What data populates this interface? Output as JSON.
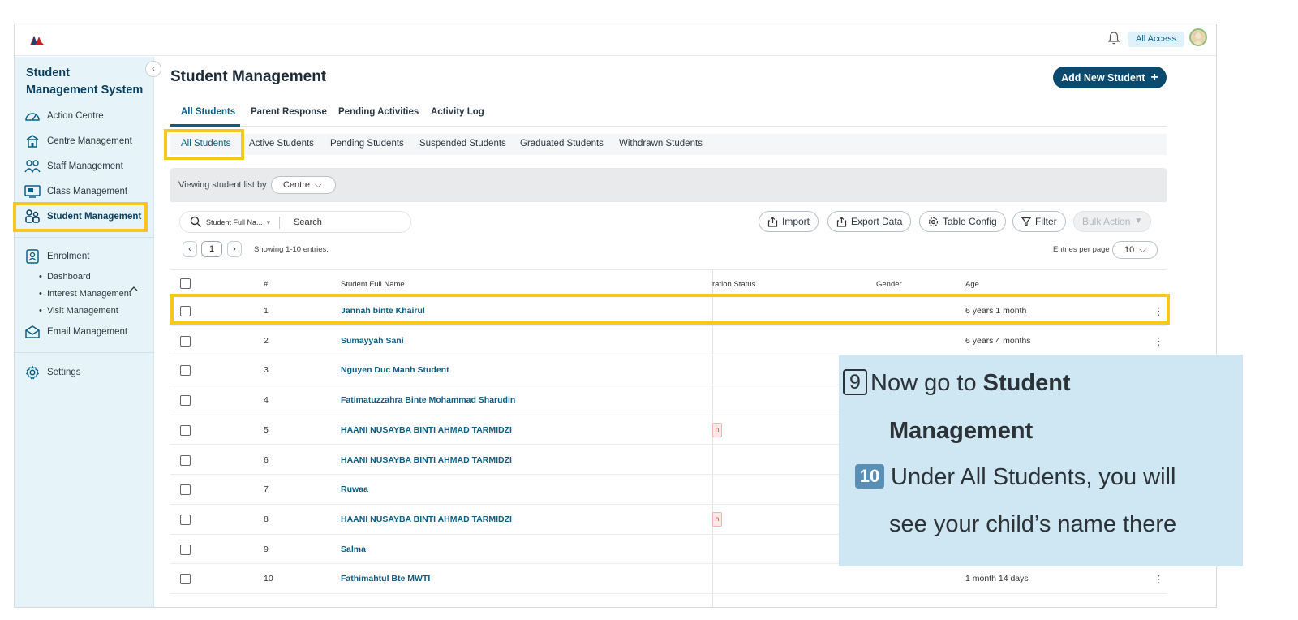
{
  "header": {
    "access_badge": "All Access"
  },
  "sidebar": {
    "title": "Student Management System",
    "items": [
      {
        "label": "Action Centre",
        "icon": "gauge-icon"
      },
      {
        "label": "Centre Management",
        "icon": "school-building-icon"
      },
      {
        "label": "Staff Management",
        "icon": "staff-group-icon"
      },
      {
        "label": "Class Management",
        "icon": "class-board-icon"
      },
      {
        "label": "Student Management",
        "icon": "students-icon"
      },
      {
        "label": "Enrolment",
        "icon": "enrolment-icon"
      },
      {
        "label": "Email Management",
        "icon": "email-icon"
      },
      {
        "label": "Settings",
        "icon": "gear-icon"
      }
    ],
    "enrolment_sub": [
      "Dashboard",
      "Interest Management",
      "Visit Management"
    ]
  },
  "main": {
    "title": "Student Management",
    "add_button": "Add New Student",
    "tabs": [
      "All Students",
      "Parent Response",
      "Pending Activities",
      "Activity Log"
    ],
    "subtabs": [
      "All Students",
      "Active Students",
      "Pending Students",
      "Suspended Students",
      "Graduated Students",
      "Withdrawn Students"
    ],
    "viewing_label": "Viewing student list by",
    "viewing_value": "Centre",
    "search": {
      "field": "Student Full Na...",
      "placeholder": "Search"
    },
    "actions": {
      "import": "Import",
      "export": "Export Data",
      "table_config": "Table Config",
      "filter": "Filter",
      "bulk_action": "Bulk Action"
    },
    "pagination": {
      "page": "1",
      "showing": "Showing 1-10 entries.",
      "entries_label": "Entries per page",
      "entries_value": "10"
    },
    "table": {
      "headers": [
        "#",
        "Student Full Name",
        "ration Status",
        "Gender",
        "Age"
      ],
      "rows": [
        {
          "num": "1",
          "name": "Jannah binte Khairul",
          "age": "6 years 1 month"
        },
        {
          "num": "2",
          "name": "Sumayyah Sani",
          "age": "6 years 4 months"
        },
        {
          "num": "3",
          "name": "Nguyen Duc Manh Student",
          "age": ""
        },
        {
          "num": "4",
          "name": "Fatimatuzzahra Binte Mohammad Sharudin",
          "age": ""
        },
        {
          "num": "5",
          "name": "HAANI NUSAYBA BINTI AHMAD TARMIDZI",
          "age": "",
          "tag": "n"
        },
        {
          "num": "6",
          "name": "HAANI NUSAYBA BINTI AHMAD TARMIDZI",
          "age": ""
        },
        {
          "num": "7",
          "name": "Ruwaa",
          "age": ""
        },
        {
          "num": "8",
          "name": "HAANI NUSAYBA BINTI AHMAD TARMIDZI",
          "age": "",
          "tag": "n"
        },
        {
          "num": "9",
          "name": "Salma",
          "age": ""
        },
        {
          "num": "10",
          "name": "Fathimahtul Bte MWTI",
          "age": "1 month 14 days"
        }
      ]
    }
  },
  "callout": {
    "step9_num": "9",
    "step9_text": "Now go to",
    "step9_bold_a": "Student",
    "step9_bold_b": "Management",
    "step10_num": "10",
    "step10_text_a": "Under All Students, you will",
    "step10_text_b": "see your child’s name there"
  },
  "colors": {
    "accent": "#0b5e84",
    "primary_button": "#0b4a6e",
    "highlight": "#f7c81b",
    "sidebar_bg": "#e6f4f9",
    "callout_bg": "#cfe7f2"
  }
}
